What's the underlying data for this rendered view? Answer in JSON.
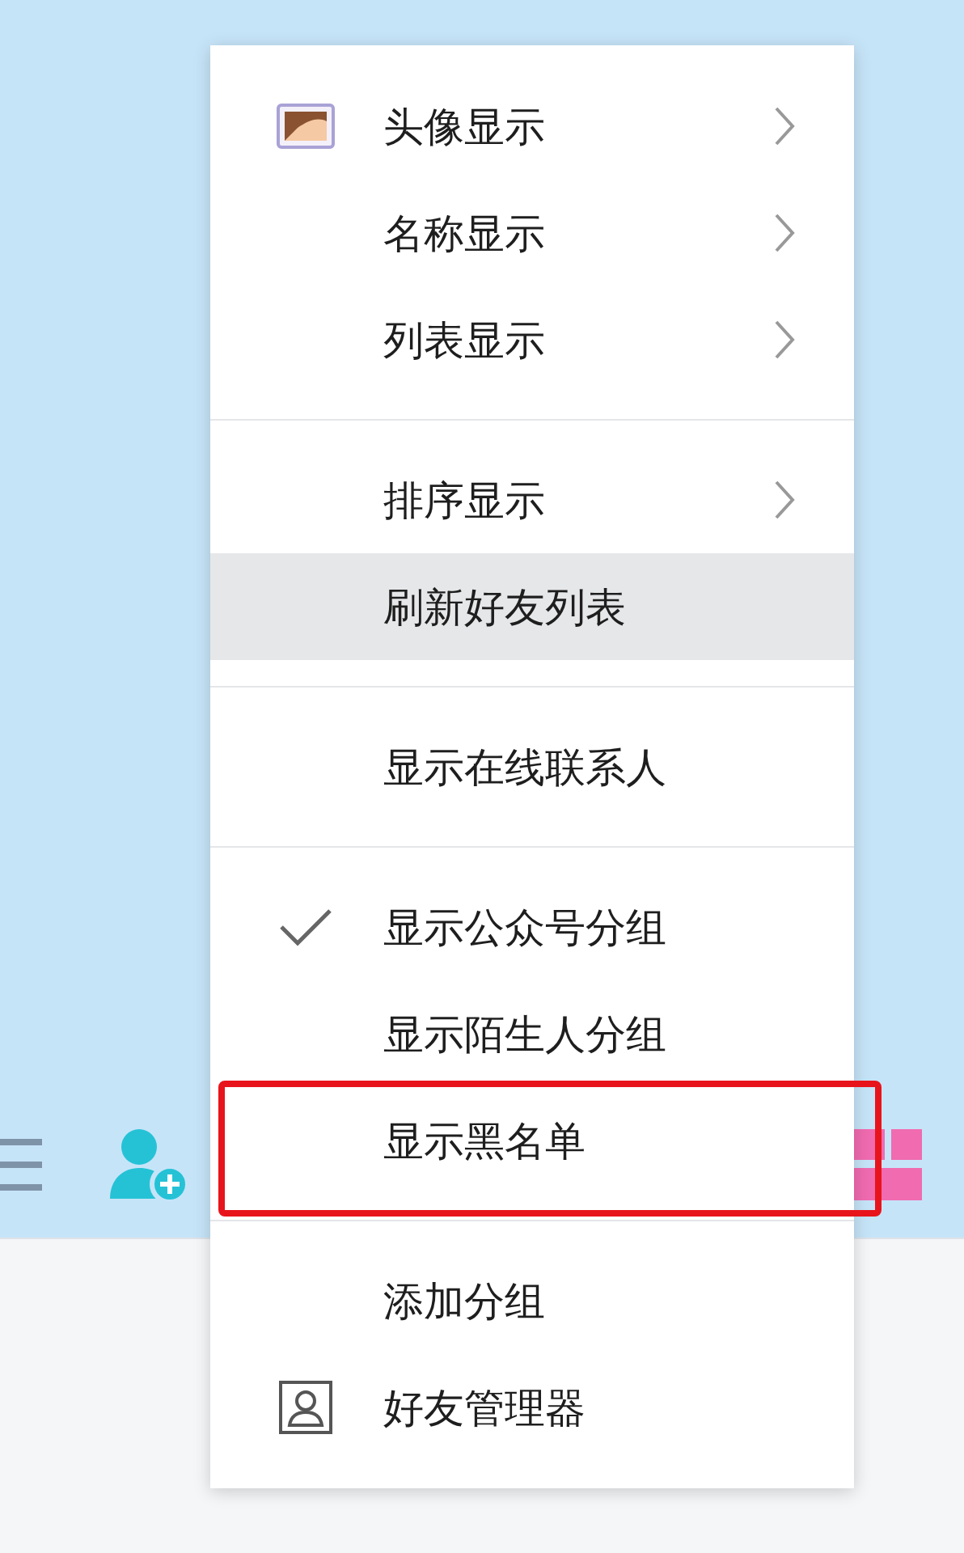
{
  "context_menu": {
    "groups": [
      {
        "items": [
          {
            "label": "头像显示",
            "kind": "avatar",
            "submenu": true,
            "selected": false,
            "outlined": false
          },
          {
            "label": "名称显示",
            "kind": "plain",
            "submenu": true,
            "selected": false,
            "outlined": false
          },
          {
            "label": "列表显示",
            "kind": "plain",
            "submenu": true,
            "selected": false,
            "outlined": false
          }
        ]
      },
      {
        "items": [
          {
            "label": "排序显示",
            "kind": "plain",
            "submenu": true,
            "selected": false,
            "outlined": false
          },
          {
            "label": "刷新好友列表",
            "kind": "plain",
            "submenu": false,
            "selected": true,
            "outlined": false
          }
        ]
      },
      {
        "items": [
          {
            "label": "显示在线联系人",
            "kind": "plain",
            "submenu": false,
            "selected": false,
            "outlined": false
          }
        ]
      },
      {
        "items": [
          {
            "label": "显示公众号分组",
            "kind": "plain",
            "submenu": false,
            "selected": false,
            "checked": true,
            "outlined": false
          },
          {
            "label": "显示陌生人分组",
            "kind": "plain",
            "submenu": false,
            "selected": false,
            "checked": false,
            "outlined": false
          },
          {
            "label": "显示黑名单",
            "kind": "plain",
            "submenu": false,
            "selected": false,
            "checked": false,
            "outlined": true
          }
        ]
      },
      {
        "items": [
          {
            "label": "添加分组",
            "kind": "plain",
            "submenu": false,
            "selected": false,
            "outlined": false
          },
          {
            "label": "好友管理器",
            "kind": "contact",
            "submenu": false,
            "selected": false,
            "outlined": false
          }
        ]
      }
    ]
  }
}
